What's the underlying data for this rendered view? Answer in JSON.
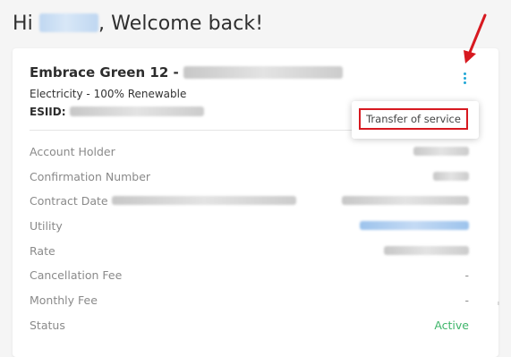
{
  "header": {
    "greeting": "Hi",
    "welcome_suffix": ", Welcome back!"
  },
  "plan": {
    "title_prefix": "Embrace Green 12 - ",
    "subtitle": "Electricity - 100% Renewable",
    "esiid_label": "ESIID:",
    "menu_icon": "vertical-ellipsis-icon"
  },
  "menu": {
    "items": [
      {
        "label": "Transfer of service"
      }
    ]
  },
  "details": {
    "rows": [
      {
        "label": "Account Holder",
        "value": ""
      },
      {
        "label": "Confirmation Number",
        "value": ""
      },
      {
        "label": "Contract Date",
        "value": ""
      },
      {
        "label": "Utility",
        "value": ""
      },
      {
        "label": "Rate",
        "value": ""
      },
      {
        "label": "Cancellation Fee",
        "value": "-"
      },
      {
        "label": "Monthly Fee",
        "value": "-"
      },
      {
        "label": "Status",
        "value": "Active"
      }
    ]
  },
  "colors": {
    "accent_blue": "#21a7d6",
    "highlight_red": "#d71920",
    "status_active": "#3eb56a",
    "page_background": "#f5f5f5",
    "card_background": "#ffffff"
  }
}
